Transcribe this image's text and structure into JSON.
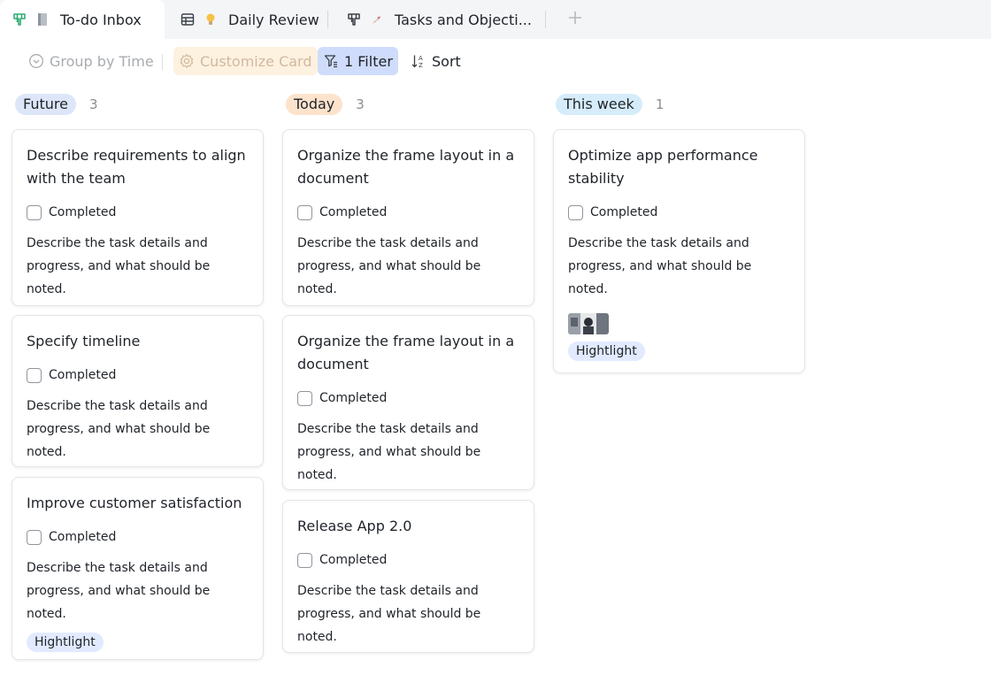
{
  "tabs": [
    {
      "label": "To-do Inbox",
      "icon": "kanban-icon",
      "icon2": "notebook-icon",
      "active": true
    },
    {
      "label": "Daily Review",
      "icon": "table-icon",
      "icon2": "lightbulb-icon",
      "active": false
    },
    {
      "label": "Tasks and Objecti...",
      "icon": "kanban-icon",
      "icon2": "rocket-icon",
      "active": false
    }
  ],
  "add_tab_icon": "plus-icon",
  "toolbar": {
    "group_label": "Group by Time",
    "customize_label": "Customize Card",
    "filter_label": "1 Filter",
    "sort_label": "Sort"
  },
  "columns": [
    {
      "tag": "Future",
      "count": "3",
      "tag_color": "#dde6f9",
      "cards": [
        {
          "title": "Describe requirements to align with the team",
          "completed_label": "Completed",
          "desc": "Describe the task details and progress, and what should be noted.",
          "tag": ""
        },
        {
          "title": "Specify timeline",
          "completed_label": "Completed",
          "desc": "Describe the task details and progress, and what should be noted.",
          "tag": ""
        },
        {
          "title": "Improve customer satisfaction",
          "completed_label": "Completed",
          "desc": "Describe the task details and progress, and what should be noted.",
          "tag": "Hightlight"
        }
      ]
    },
    {
      "tag": "Today",
      "count": "3",
      "tag_color": "#fde3cc",
      "cards": [
        {
          "title": "Organize the frame layout in a document",
          "completed_label": "Completed",
          "desc": "Describe the task details and progress, and what should be noted.",
          "tag": ""
        },
        {
          "title": "Organize the frame layout in a document",
          "completed_label": "Completed",
          "desc": "Describe the task details and progress, and what should be noted.",
          "tag": ""
        },
        {
          "title": "Release App 2.0",
          "completed_label": "Completed",
          "desc": "Describe the task details and progress, and what should be noted.",
          "tag": ""
        }
      ]
    },
    {
      "tag": "This week",
      "count": "1",
      "tag_color": "#d6ecfa",
      "cards": [
        {
          "title": "Optimize app performance stability",
          "completed_label": "Completed",
          "desc": "Describe the task details and progress, and what should be noted.",
          "has_image": true,
          "tag": "Hightlight"
        }
      ]
    }
  ]
}
